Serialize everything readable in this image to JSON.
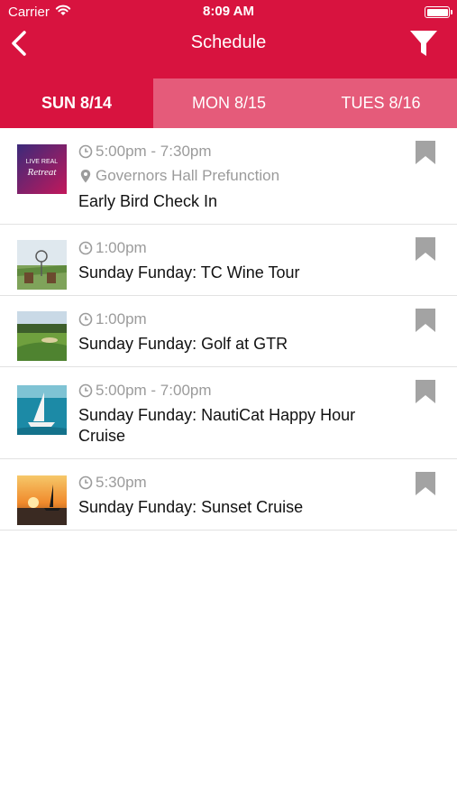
{
  "status_bar": {
    "carrier": "Carrier",
    "time": "8:09 AM"
  },
  "header": {
    "title": "Schedule"
  },
  "tabs": [
    {
      "label": "SUN 8/14",
      "active": true
    },
    {
      "label": "MON 8/15",
      "active": false
    },
    {
      "label": "TUES 8/16",
      "active": false
    }
  ],
  "events": [
    {
      "time": "5:00pm - 7:30pm",
      "location": "Governors Hall Prefunction",
      "name": "Early Bird Check In",
      "thumb": "live-unreal-retreat-logo",
      "logo_text": {
        "top": "LIVE REAL",
        "script": "Retreat"
      }
    },
    {
      "time": "1:00pm",
      "name": "Sunday Funday: TC Wine Tour",
      "thumb": "wine-tour-photo"
    },
    {
      "time": "1:00pm",
      "name": "Sunday Funday: Golf at GTR",
      "thumb": "golf-course-photo"
    },
    {
      "time": "5:00pm - 7:00pm",
      "name": "Sunday Funday: NautiCat Happy Hour Cruise",
      "thumb": "catamaran-photo"
    },
    {
      "time": "5:30pm",
      "name": "Sunday Funday: Sunset Cruise",
      "thumb": "sunset-sailboat-photo"
    }
  ],
  "colors": {
    "brand": "#d8133f",
    "tab_inactive": "#e55b7a",
    "meta_text": "#9b9b9b",
    "bookmark": "#a3a3a3"
  }
}
